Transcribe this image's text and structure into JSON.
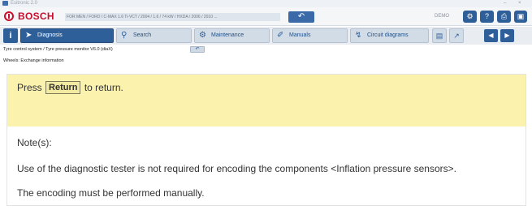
{
  "window": {
    "title": "Esitronic 2.0",
    "minimize": "–",
    "close": "×"
  },
  "brand": {
    "name": "BOSCH",
    "vehicle": "FOR MEN / FORD / C-MAX 1.6 Ti-VCT / 2004 / 1.6 / 74 kW / HXDA / 2006 / 2010 ...",
    "mode": "DEMO"
  },
  "tabs": [
    {
      "label": "Diagnosis",
      "active": true
    },
    {
      "label": "Search"
    },
    {
      "label": "Maintenance"
    },
    {
      "label": "Manuals"
    },
    {
      "label": "Circuit diagrams"
    }
  ],
  "breadcrumb": "Tyre control system / Tyre pressure monitor V6.0 (diaX)",
  "subbreadcrumb": "Wheels: Exchange information",
  "prompt": {
    "prefix": "Press",
    "button": "Return",
    "suffix": "to return."
  },
  "notes": {
    "title": "Note(s):",
    "lines": [
      "Use of the diagnostic tester is not required for encoding the components <Inflation pressure sensors>.",
      "The encoding must be performed manually."
    ]
  },
  "icons": {
    "back": "back-arrow-icon",
    "info": "info-icon",
    "tabs": [
      "car-diagnosis-icon",
      "magnifier-icon",
      "gears-icon",
      "wrench-icon",
      "pulse-icon"
    ]
  },
  "colors": {
    "brand_red": "#c8102e",
    "accent_blue": "#2f5f99",
    "prompt_bg": "#fbf2ad"
  }
}
